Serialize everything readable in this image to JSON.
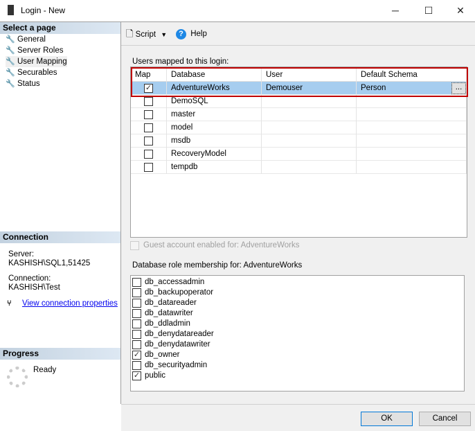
{
  "window": {
    "title": "Login - New",
    "minimize": "─",
    "maximize": "☐",
    "close": "✕"
  },
  "left": {
    "select_page": "Select a page",
    "pages": [
      {
        "label": "General"
      },
      {
        "label": "Server Roles"
      },
      {
        "label": "User Mapping"
      },
      {
        "label": "Securables"
      },
      {
        "label": "Status"
      }
    ],
    "connection_header": "Connection",
    "server_label": "Server:",
    "server_value": "KASHISH\\SQL1,51425",
    "connection_label": "Connection:",
    "connection_value": "KASHISH\\Test",
    "view_props": "View connection properties",
    "progress_header": "Progress",
    "progress_status": "Ready"
  },
  "toolbar": {
    "script": "Script",
    "help": "Help"
  },
  "mapping": {
    "label": "Users mapped to this login:",
    "columns": [
      "Map",
      "Database",
      "User",
      "Default Schema"
    ],
    "rows": [
      {
        "map": true,
        "database": "AdventureWorks",
        "user": "Demouser",
        "schema": "Person",
        "selected": true
      },
      {
        "map": false,
        "database": "DemoSQL",
        "user": "",
        "schema": ""
      },
      {
        "map": false,
        "database": "master",
        "user": "",
        "schema": ""
      },
      {
        "map": false,
        "database": "model",
        "user": "",
        "schema": ""
      },
      {
        "map": false,
        "database": "msdb",
        "user": "",
        "schema": ""
      },
      {
        "map": false,
        "database": "RecoveryModel",
        "user": "",
        "schema": ""
      },
      {
        "map": false,
        "database": "tempdb",
        "user": "",
        "schema": ""
      }
    ],
    "browse": "..."
  },
  "guest": "Guest account enabled for: AdventureWorks",
  "roles": {
    "label": "Database role membership for: AdventureWorks",
    "items": [
      {
        "name": "db_accessadmin",
        "checked": false
      },
      {
        "name": "db_backupoperator",
        "checked": false
      },
      {
        "name": "db_datareader",
        "checked": false
      },
      {
        "name": "db_datawriter",
        "checked": false
      },
      {
        "name": "db_ddladmin",
        "checked": false
      },
      {
        "name": "db_denydatareader",
        "checked": false
      },
      {
        "name": "db_denydatawriter",
        "checked": false
      },
      {
        "name": "db_owner",
        "checked": true
      },
      {
        "name": "db_securityadmin",
        "checked": false
      },
      {
        "name": "public",
        "checked": true
      }
    ]
  },
  "buttons": {
    "ok": "OK",
    "cancel": "Cancel"
  },
  "colors": {
    "selection": "#a6cdef",
    "highlight_border": "#c00000",
    "link": "#0000ee"
  }
}
